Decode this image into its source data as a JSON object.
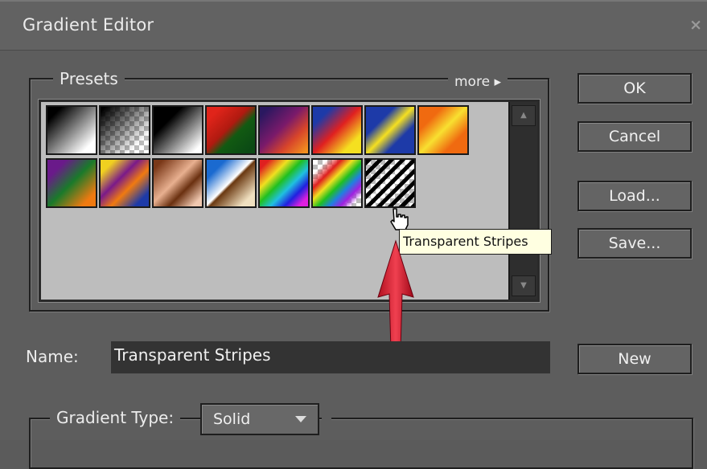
{
  "window": {
    "title": "Gradient Editor",
    "close_label": "×"
  },
  "presets": {
    "legend": "Presets",
    "more_label": "more ▸",
    "swatches": [
      {
        "name": "Black, White"
      },
      {
        "name": "Black to Transparent"
      },
      {
        "name": "Black, White 2"
      },
      {
        "name": "Red, Green"
      },
      {
        "name": "Violet, Orange"
      },
      {
        "name": "Blue, Red, Yellow"
      },
      {
        "name": "Blue, Yellow, Blue"
      },
      {
        "name": "Orange, Yellow, Orange"
      },
      {
        "name": "Violet, Green, Orange"
      },
      {
        "name": "Yellow, Violet, Orange, Blue"
      },
      {
        "name": "Copper"
      },
      {
        "name": "Chrome"
      },
      {
        "name": "Spectrum"
      },
      {
        "name": "Transparent Rainbow"
      },
      {
        "name": "Transparent Stripes"
      }
    ],
    "tooltip": "Transparent Stripes"
  },
  "buttons": {
    "ok": "OK",
    "cancel": "Cancel",
    "load": "Load...",
    "save": "Save...",
    "new": "New"
  },
  "name": {
    "label": "Name:",
    "value": "Transparent Stripes"
  },
  "gradient_type": {
    "legend": "Gradient Type:",
    "value": "Solid"
  }
}
